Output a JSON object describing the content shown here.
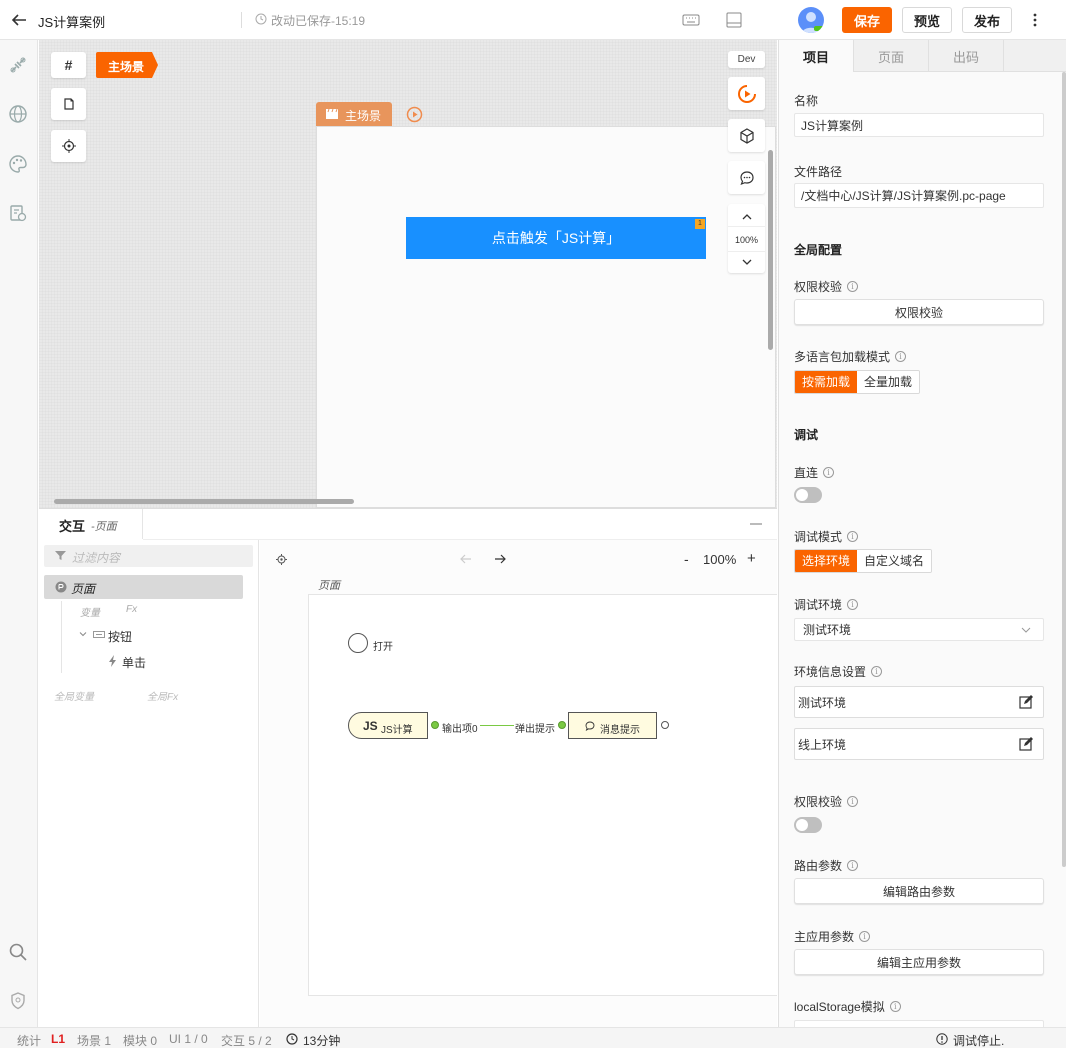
{
  "header": {
    "title": "JS计算案例",
    "save_status": "改动已保存-15:19",
    "save_label": "保存",
    "preview_label": "预览",
    "publish_label": "发布"
  },
  "canvas": {
    "hash_label": "#",
    "scene_tag": "主场景",
    "frame_label": "主场景",
    "dev_label": "Dev",
    "zoom": "100%",
    "trigger_button": "点击触发「JS计算」",
    "badge": "1"
  },
  "interaction": {
    "title": "交互",
    "subtitle": "-页面",
    "filter_placeholder": "过滤内容",
    "tree": {
      "page": "页面",
      "var": "变量",
      "fx": "Fx",
      "button": "按钮",
      "click": "单击",
      "global_var": "全局变量",
      "global_fx": "全局Fx"
    },
    "zoom": "100%",
    "page_label": "页面",
    "nodes": {
      "open": "打开",
      "js_prefix": "JS",
      "js": "JS计算",
      "out": "输出项0",
      "popup": "弹出提示",
      "msg": "消息提示"
    }
  },
  "rightpanel": {
    "tabs": [
      "项目",
      "页面",
      "出码"
    ],
    "name_label": "名称",
    "name_value": "JS计算案例",
    "path_label": "文件路径",
    "path_value": "/文档中心/JS计算/JS计算案例.pc-page",
    "global_config": "全局配置",
    "auth_label": "权限校验",
    "auth_btn": "权限校验",
    "lang_label": "多语言包加载模式",
    "lang_opts": [
      "按需加载",
      "全量加载"
    ],
    "debug_title": "调试",
    "direct_label": "直连",
    "debug_mode_label": "调试模式",
    "debug_mode_opts": [
      "选择环境",
      "自定义域名"
    ],
    "debug_env_label": "调试环境",
    "debug_env_value": "测试环境",
    "env_info_label": "环境信息设置",
    "env_test": "测试环境",
    "env_online": "线上环境",
    "auth2_label": "权限校验",
    "route_label": "路由参数",
    "route_btn": "编辑路由参数",
    "main_app_label": "主应用参数",
    "main_app_btn": "编辑主应用参数",
    "ls_label": "localStorage模拟"
  },
  "statusbar": {
    "stats": "统计",
    "level": "L1",
    "scene": "场景 1",
    "module": "模块 0",
    "ui": "UI 1 / 0",
    "interaction": "交互 5 / 2",
    "time": "13分钟",
    "debug_status": "调试停止."
  },
  "colors": {
    "accent": "#fa6400",
    "primary_blue": "#1890ff",
    "scene_tag": "#e8955c"
  }
}
